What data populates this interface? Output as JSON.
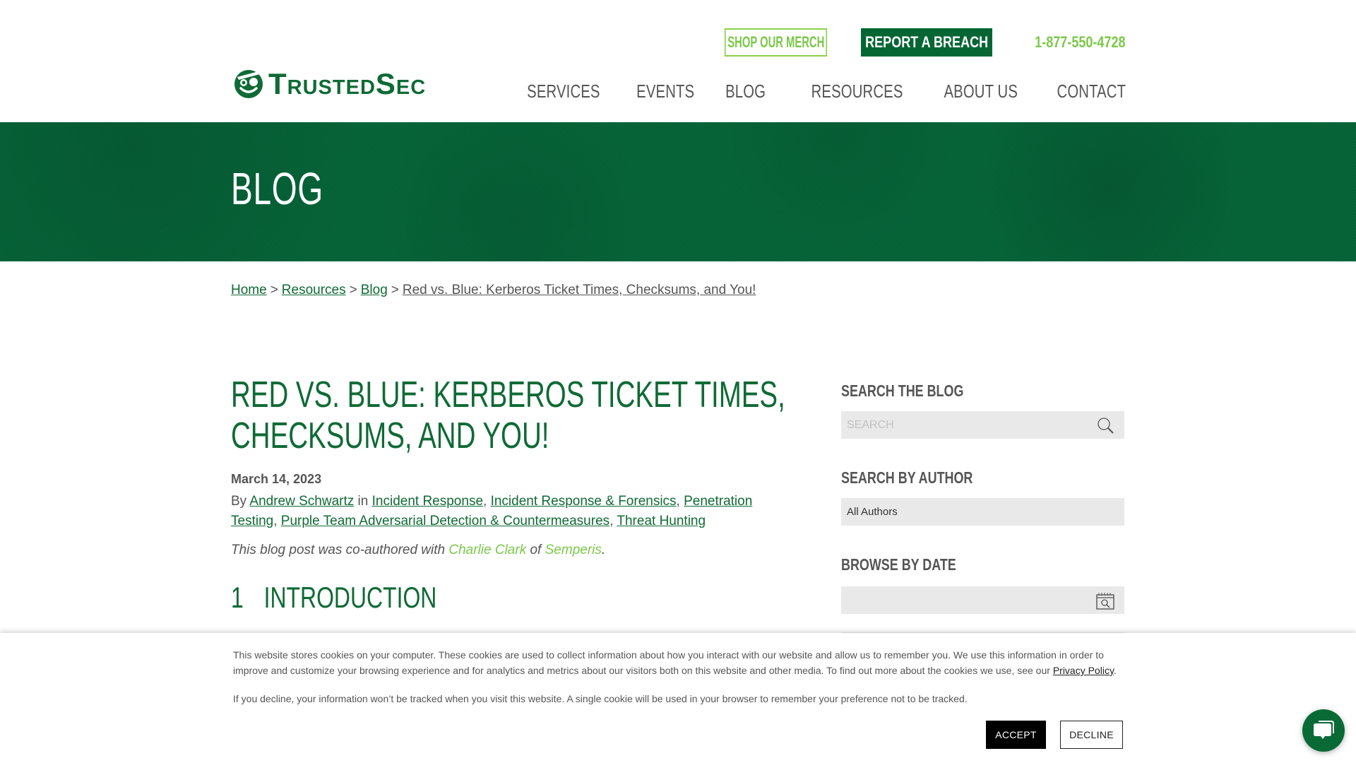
{
  "header": {
    "logo_text": "TrustedSec",
    "shop_merch": "SHOP OUR MERCH",
    "report_breach": "REPORT A BREACH",
    "phone": "1-877-550-4728",
    "nav": [
      "SERVICES",
      "EVENTS",
      "BLOG",
      "RESOURCES",
      "ABOUT US",
      "CONTACT"
    ]
  },
  "banner": {
    "title": "BLOG"
  },
  "breadcrumb": {
    "items": [
      "Home",
      "Resources",
      "Blog",
      "Red vs. Blue: Kerberos Ticket Times, Checksums, and You!"
    ],
    "separator": ">"
  },
  "article": {
    "title": "Red vs. Blue: Kerberos Ticket Times, Checksums, and You!",
    "date": "March 14, 2023",
    "by_label": "By",
    "author": "Andrew Schwartz",
    "in_label": "in",
    "categories": [
      "Incident Response",
      "Incident Response & Forensics",
      "Penetration Testing",
      "Purple Team Adversarial Detection & Countermeasures",
      "Threat Hunting"
    ],
    "coauthor_prefix": "This blog post was co-authored with",
    "coauthor": "Charlie Clark",
    "coauthor_of": "of",
    "coauthor_org": "Semperis",
    "coauthor_suffix": ".",
    "section_number": "1",
    "section_title": "INTRODUCTION"
  },
  "sidebar": {
    "search_heading": "SEARCH THE BLOG",
    "search_placeholder": "SEARCH",
    "author_heading": "SEARCH BY AUTHOR",
    "author_selected": "All Authors",
    "date_heading": "BROWSE BY DATE",
    "date_from": "",
    "date_to": ""
  },
  "cookie": {
    "text1": "This website stores cookies on your computer. These cookies are used to collect information about how you interact with our website and allow us to remember you. We use this information in order to improve and customize your browsing experience and for analytics and metrics about our visitors both on this website and other media. To find out more about the cookies we use, see our",
    "privacy_link": "Privacy Policy",
    "text1_end": ".",
    "text2": "If you decline, your information won’t be tracked when you visit this website. A single cookie will be used in your browser to remember your preference not to be tracked.",
    "accept": "ACCEPT",
    "decline": "DECLINE"
  },
  "colors": {
    "brand_green": "#056634",
    "accent_lime": "#7cc84a",
    "text_gray": "#555555",
    "field_bg": "#e9e9e9"
  }
}
